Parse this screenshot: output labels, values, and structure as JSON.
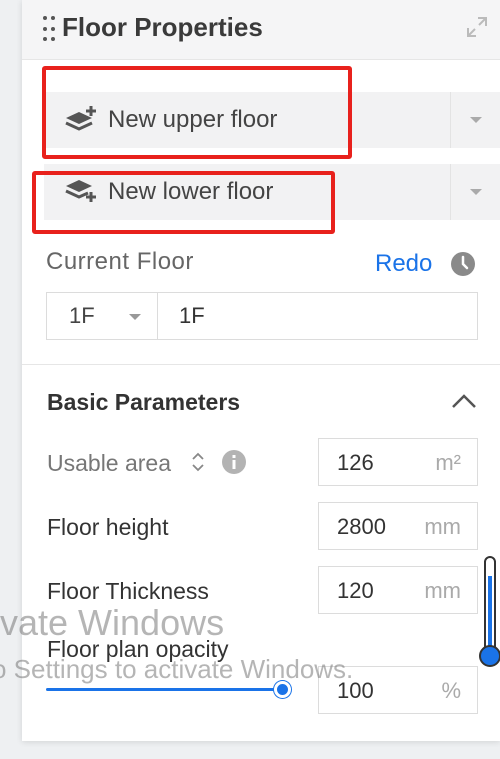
{
  "panel": {
    "title": "Floor Properties",
    "new_upper_floor": "New upper floor",
    "new_lower_floor": "New lower floor",
    "current_floor_label": "Current Floor",
    "redo": "Redo",
    "floor_select_value": "1F",
    "floor_name_value": "1F"
  },
  "basic": {
    "title": "Basic Parameters",
    "usable_area": {
      "label": "Usable area",
      "value": "126",
      "unit": "m²"
    },
    "floor_height": {
      "label": "Floor height",
      "value": "2800",
      "unit": "mm"
    },
    "floor_thickness": {
      "label": "Floor Thickness",
      "value": "120",
      "unit": "mm"
    },
    "floor_plan_opacity": {
      "label": "Floor plan opacity",
      "value": "100",
      "unit": "%",
      "slider_level_percent": 100
    }
  },
  "watermark": {
    "line1": "ivate Windows",
    "line2": "o Settings to activate Windows."
  },
  "icons": [
    "drag-handle-icon",
    "expand-icon",
    "upper-floor-icon",
    "lower-floor-icon",
    "clock-icon",
    "chevron-up-icon",
    "sort-icon",
    "info-icon"
  ],
  "colors": {
    "accent": "#1a73e8",
    "annotation": "#e8211c"
  }
}
